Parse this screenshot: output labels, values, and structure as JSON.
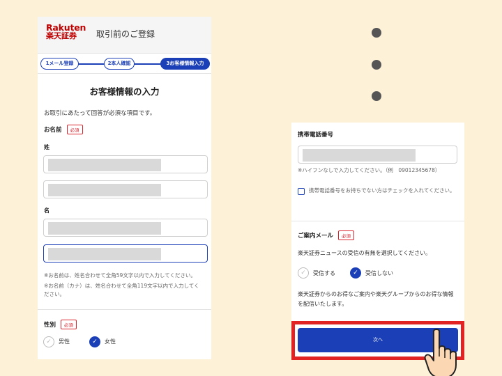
{
  "header": {
    "logo_line1": "Rakuten",
    "logo_line2": "楽天証券",
    "title": "取引前のご登録"
  },
  "steps": [
    "1メール登録",
    "2本人確認",
    "3お客様情報入力"
  ],
  "form": {
    "title": "お客様情報の入力",
    "notice": "お取引にあたって回答が必須な項目です。",
    "required_badge": "必須",
    "name_label": "お名前",
    "sei_label": "姓",
    "mei_label": "名",
    "hint1": "※お名前は、姓名合わせて全角59文字以内で入力してください。",
    "hint2": "※お名前（カナ）は、姓名合わせて全角119文字以内で入力してください。",
    "gender_label": "性別",
    "gender_options": [
      "男性",
      "女性"
    ],
    "gender_selected": "女性"
  },
  "right": {
    "phone_label": "携帯電話番号",
    "phone_hint": "※ハイフンなしで入力してください。（例　09012345678）",
    "no_phone_check": "携帯電話番号をお持ちでない方はチェックを入れてください。",
    "mail_label": "ご案内メール",
    "mail_desc": "楽天証券ニュースの受信の有無を選択してください。",
    "mail_options": [
      "受信する",
      "受信しない"
    ],
    "mail_selected": "受信しない",
    "mail_note": "楽天証券からのお得なご案内や楽天グループからのお得な情報を配信いたします。",
    "next_button": "次へ"
  },
  "colors": {
    "background": "#fdf1d8",
    "brand_red": "#bf0000",
    "primary_blue": "#1b3fb6",
    "required_red": "#d9232d",
    "highlight_red": "#e12323"
  },
  "icons": [
    "check-icon",
    "pointing-hand-icon",
    "dot-indicator"
  ]
}
